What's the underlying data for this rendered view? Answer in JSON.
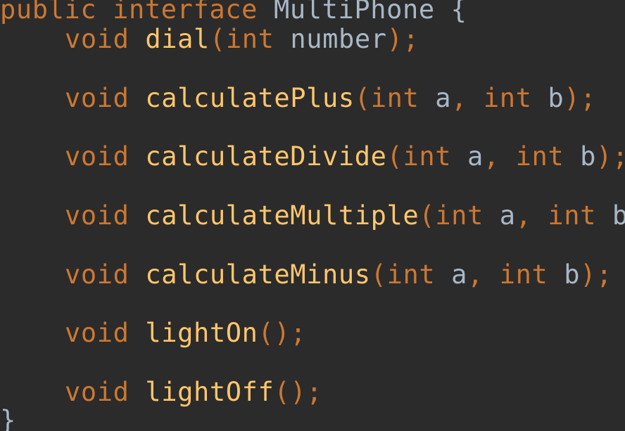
{
  "colors": {
    "background": "#2b2b2b",
    "keyword": "#cc7832",
    "method": "#ffc66d",
    "text": "#a9b7c6"
  },
  "code": {
    "header": {
      "mod": "public",
      "kw": "interface",
      "name": "MultiPhone",
      "brace": "{"
    },
    "methods": [
      {
        "ret": "void",
        "name": "dial",
        "open": "(",
        "t1": "int",
        "p1": "number",
        "close": ");"
      },
      {
        "ret": "void",
        "name": "calculatePlus",
        "open": "(",
        "t1": "int",
        "p1": "a",
        "sep": ",",
        "t2": "int",
        "p2": "b",
        "close": ");"
      },
      {
        "ret": "void",
        "name": "calculateDivide",
        "open": "(",
        "t1": "int",
        "p1": "a",
        "sep": ",",
        "t2": "int",
        "p2": "b",
        "close": ");"
      },
      {
        "ret": "void",
        "name": "calculateMultiple",
        "open": "(",
        "t1": "int",
        "p1": "a",
        "sep": ",",
        "t2": "int",
        "p2": "b",
        "close": ");"
      },
      {
        "ret": "void",
        "name": "calculateMinus",
        "open": "(",
        "t1": "int",
        "p1": "a",
        "sep": ",",
        "t2": "int",
        "p2": "b",
        "close": ");"
      },
      {
        "ret": "void",
        "name": "lightOn",
        "open": "(",
        "close": ");"
      },
      {
        "ret": "void",
        "name": "lightOff",
        "open": "(",
        "close": ");"
      }
    ],
    "footer": {
      "brace": "}"
    }
  }
}
